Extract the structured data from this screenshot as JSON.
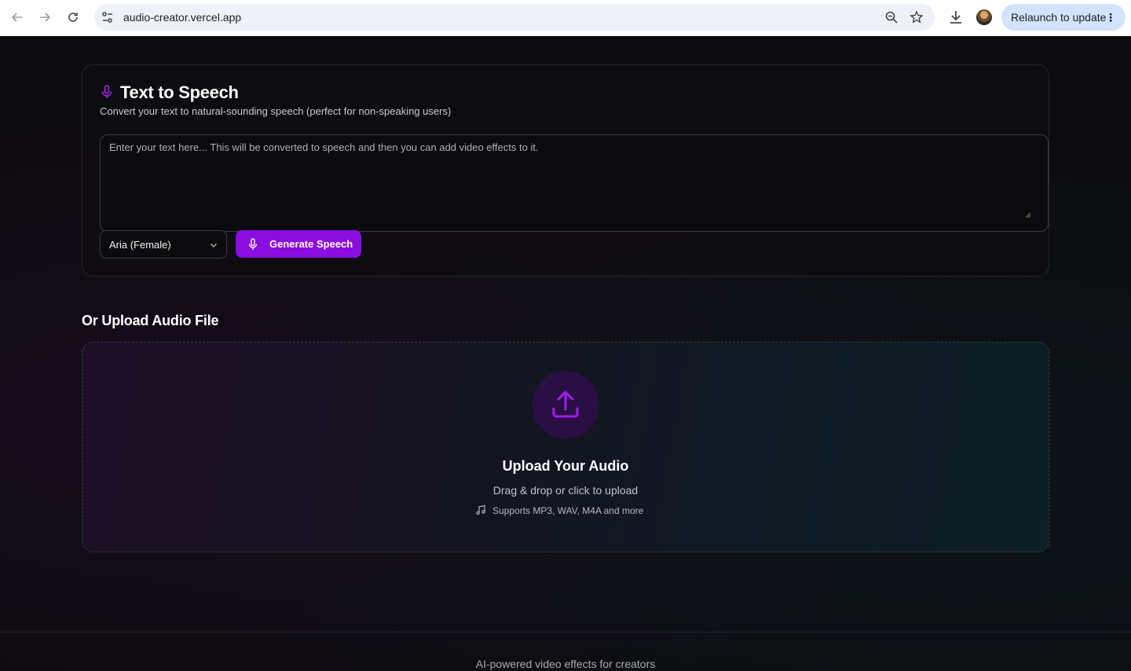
{
  "browser": {
    "url": "audio-creator.vercel.app",
    "relaunch_label": "Relaunch to update"
  },
  "tts": {
    "title": "Text to Speech",
    "subtitle": "Convert your text to natural-sounding speech (perfect for non-speaking users)",
    "textarea_placeholder": "Enter your text here... This will be converted to speech and then you can add video effects to it.",
    "voice_selected": "Aria (Female)",
    "generate_label": "Generate Speech"
  },
  "upload": {
    "heading": "Or Upload Audio File",
    "title": "Upload Your Audio",
    "subtitle": "Drag & drop or click to upload",
    "support": "Supports MP3, WAV, M4A and more"
  },
  "footer": {
    "tagline": "AI-powered video effects for creators"
  },
  "colors": {
    "accent": "#8a0ee0",
    "background": "#0c0b0e"
  }
}
